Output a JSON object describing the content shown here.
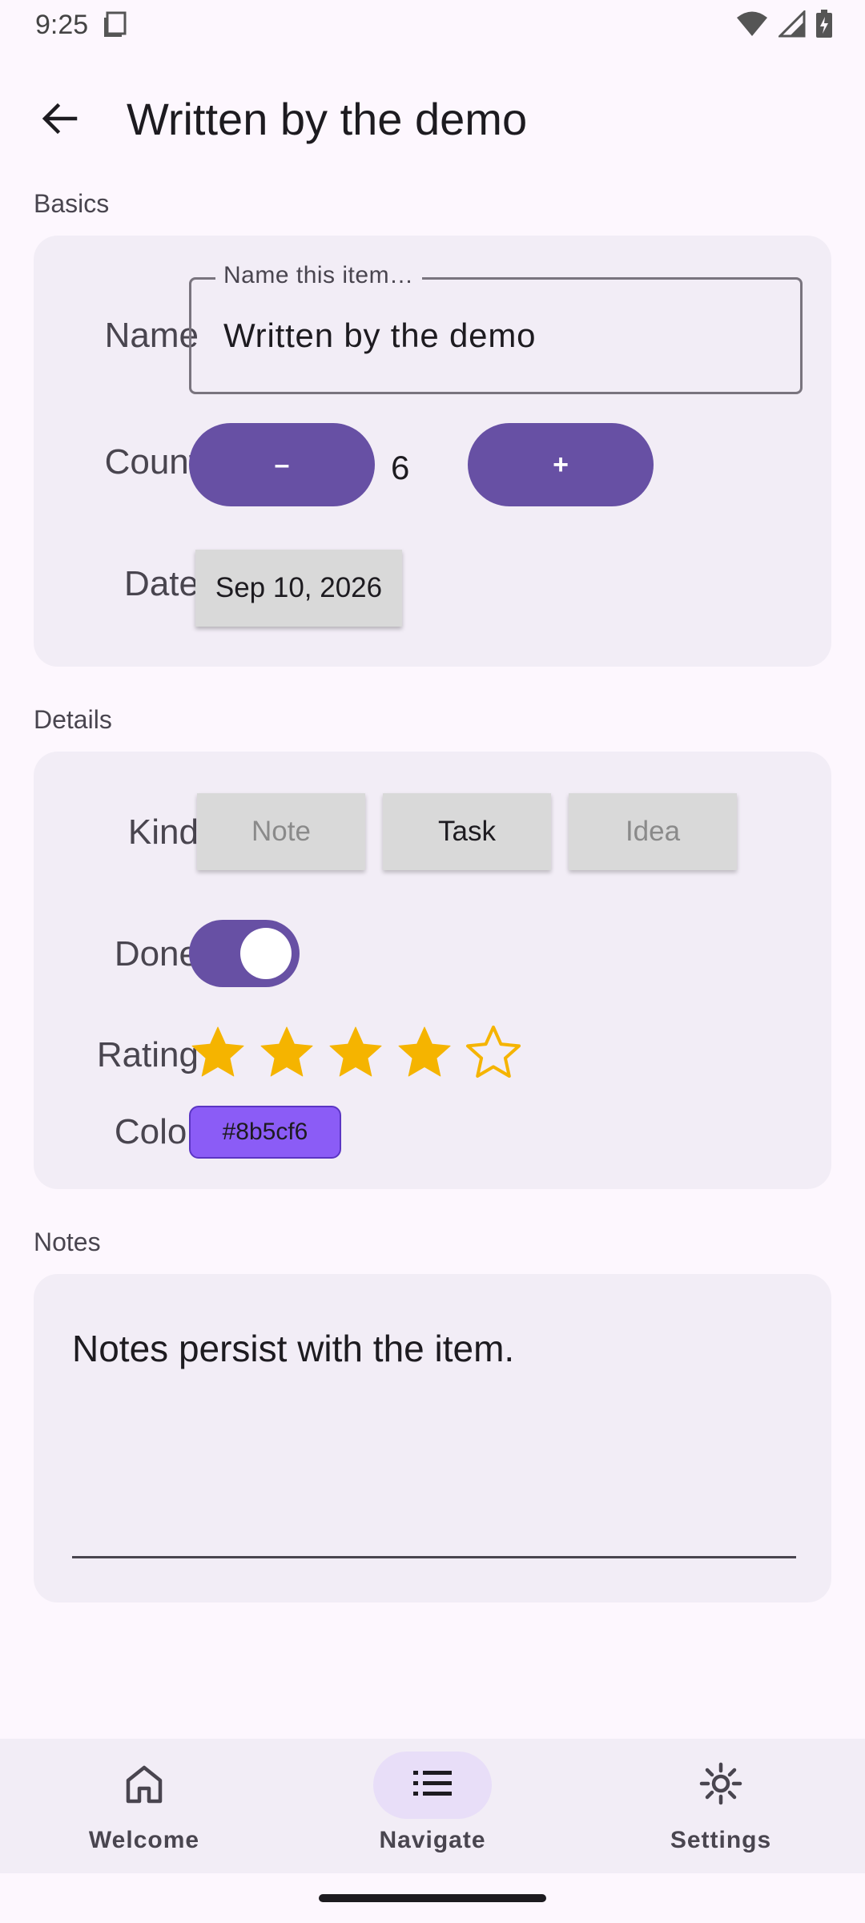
{
  "status_bar": {
    "time": "9:25"
  },
  "header": {
    "title": "Written by the demo"
  },
  "basics": {
    "section_label": "Basics",
    "name_label": "Name",
    "name_field_label": "Name this item…",
    "name_value": "Written by the demo",
    "count_label": "Count",
    "decrement_label": "–",
    "count_value": "6",
    "increment_label": "+",
    "date_label": "Date",
    "date_value": "Sep 10, 2026"
  },
  "details": {
    "section_label": "Details",
    "kind_label": "Kind",
    "kind_options": [
      "Note",
      "Task",
      "Idea"
    ],
    "kind_selected": "Task",
    "done_label": "Done",
    "done_value": true,
    "rating_label": "Rating",
    "rating_value": 4,
    "rating_max": 5,
    "color_label": "Color",
    "color_value": "#8b5cf6"
  },
  "notes": {
    "section_label": "Notes",
    "text": "Notes persist with the item."
  },
  "bottom_nav": {
    "items": [
      {
        "label": "Welcome",
        "icon": "home-icon",
        "active": false
      },
      {
        "label": "Navigate",
        "icon": "list-icon",
        "active": true
      },
      {
        "label": "Settings",
        "icon": "settings-icon",
        "active": false
      }
    ]
  },
  "colors": {
    "primary": "#6750a4",
    "star": "#f5b400",
    "background": "#fdf7fe",
    "card": "#f2edf6"
  }
}
